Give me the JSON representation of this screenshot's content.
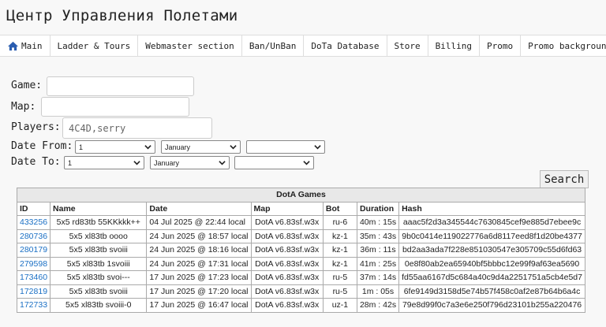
{
  "page_title": "Центр Управления Полетами",
  "nav": {
    "items": [
      {
        "label": "Main",
        "icon": "home-icon"
      },
      {
        "label": "Ladder & Tours"
      },
      {
        "label": "Webmaster section"
      },
      {
        "label": "Ban/UnBan"
      },
      {
        "label": "DoTa Database"
      },
      {
        "label": "Store"
      },
      {
        "label": "Billing"
      },
      {
        "label": "Promo"
      },
      {
        "label": "Promo background"
      }
    ]
  },
  "form": {
    "game_label": "Game:",
    "game_value": "",
    "map_label": "Map:",
    "map_value": "",
    "players_label": "Players:",
    "players_placeholder": "4C4D,serry",
    "date_from_label": "Date From:",
    "date_to_label": "Date To:",
    "date_from": {
      "day": "1",
      "month": "January",
      "year": ""
    },
    "date_to": {
      "day": "1",
      "month": "January",
      "year": ""
    },
    "search_label": "Search"
  },
  "table": {
    "caption": "DotA Games",
    "columns": [
      "ID",
      "Name",
      "Date",
      "Map",
      "Bot",
      "Duration",
      "Hash"
    ],
    "rows": [
      {
        "id": "433256",
        "name": "5x5 rd83tb 55KKkkk++",
        "date": "04 Jul 2025 @ 22:44 local",
        "map": "DotA v6.83sf.w3x",
        "bot": "ru-6",
        "duration": "40m : 15s",
        "hash": "aaac5f2d3a345544c7630845cef9e885d7ebee9c"
      },
      {
        "id": "280736",
        "name": "5x5 xl83tb oooo",
        "date": "24 Jun 2025 @ 18:57 local",
        "map": "DotA v6.83sf.w3x",
        "bot": "kz-1",
        "duration": "35m : 43s",
        "hash": "9b0c0414e119022776a6d8117eed8f1d20be4377"
      },
      {
        "id": "280179",
        "name": "5x5 xl83tb svoiii",
        "date": "24 Jun 2025 @ 18:16 local",
        "map": "DotA v6.83sf.w3x",
        "bot": "kz-1",
        "duration": "36m : 11s",
        "hash": "bd2aa3ada7f228e851030547e305709c55d6fd63"
      },
      {
        "id": "279598",
        "name": "5x5 xl83tb 1svoiii",
        "date": "24 Jun 2025 @ 17:31 local",
        "map": "DotA v6.83sf.w3x",
        "bot": "kz-1",
        "duration": "41m : 25s",
        "hash": "0e8f80ab2ea65940bf5bbbc12e99f9af63ea5690"
      },
      {
        "id": "173460",
        "name": "5x5 xl83tb svoi---",
        "date": "17 Jun 2025 @ 17:23 local",
        "map": "DotA v6.83sf.w3x",
        "bot": "ru-5",
        "duration": "37m : 14s",
        "hash": "fd55aa6167d5c684a40c9d4a2251751a5cb4e5d7"
      },
      {
        "id": "172819",
        "name": "5x5 xl83tb svoiii",
        "date": "17 Jun 2025 @ 17:20 local",
        "map": "DotA v6.83sf.w3x",
        "bot": "ru-5",
        "duration": "1m : 05s",
        "hash": "6fe9149d3158d5e74b57f458c0af2e87b64b6a4c"
      },
      {
        "id": "172733",
        "name": "5x5 xl83tb svoiii-0",
        "date": "17 Jun 2025 @ 16:47 local",
        "map": "DotA v6.83sf.w3x",
        "bot": "uz-1",
        "duration": "28m : 42s",
        "hash": "79e8d99f0c7a3e6e250f796d23101b255a220476"
      }
    ]
  },
  "colors": {
    "link": "#1a6fc4",
    "home_icon": "#2a5db0"
  }
}
